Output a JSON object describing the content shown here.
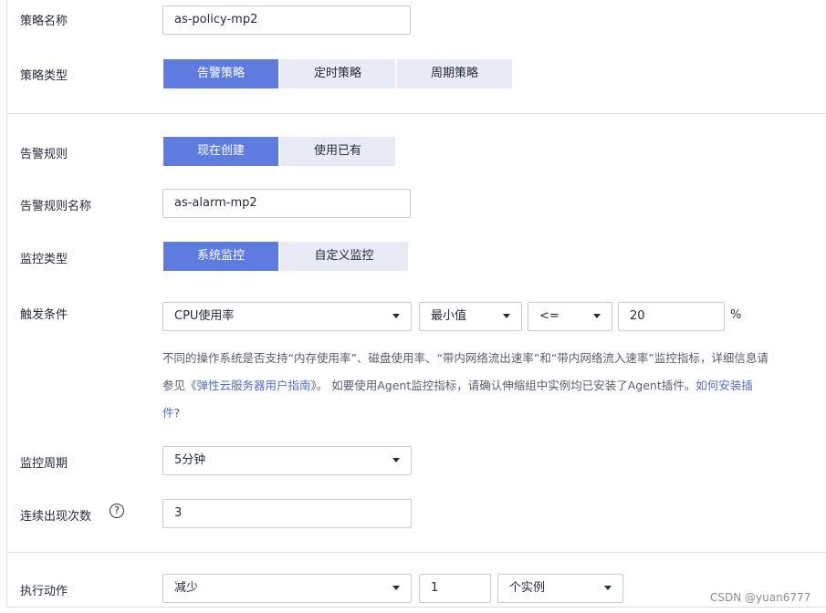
{
  "policy": {
    "name_label": "策略名称",
    "name_value": "as-policy-mp2",
    "type_label": "策略类型",
    "type_options": [
      "告警策略",
      "定时策略",
      "周期策略"
    ]
  },
  "alarm_rule": {
    "label": "告警规则",
    "options": [
      "现在创建",
      "使用已有"
    ],
    "name_label": "告警规则名称",
    "name_value": "as-alarm-mp2"
  },
  "monitor_type": {
    "label": "监控类型",
    "options": [
      "系统监控",
      "自定义监控"
    ]
  },
  "trigger": {
    "label": "触发条件",
    "metric": "CPU使用率",
    "aggregation": "最小值",
    "operator": "<=",
    "threshold": "20",
    "unit": "%",
    "hint_line1": "不同的操作系统是否支持“内存使用率”、磁盘使用率、“带内网络流出速率”和“带内网络流入速率”监控指标，详细信息请",
    "hint_line2_pre": "参见《",
    "hint_link1": "弹性云服务器用户指南",
    "hint_line2_mid": "》。 如要使用Agent监控指标，请确认伸缩组中实例均已安装了Agent插件。",
    "hint_link2a": "如何安装插",
    "hint_link2b": "件",
    "hint_q": "?"
  },
  "period": {
    "label": "监控周期",
    "value": "5分钟"
  },
  "occurrences": {
    "label": "连续出现次数",
    "help": "?",
    "value": "3"
  },
  "action": {
    "label": "执行动作",
    "type": "减少",
    "count": "1",
    "unit": "个实例"
  },
  "watermark": "CSDN @yuan6777",
  "colors": {
    "accent": "#5e7ce0",
    "segment_bg": "#e8ebf5",
    "link": "#526ecc",
    "border": "#c7cbd2"
  }
}
